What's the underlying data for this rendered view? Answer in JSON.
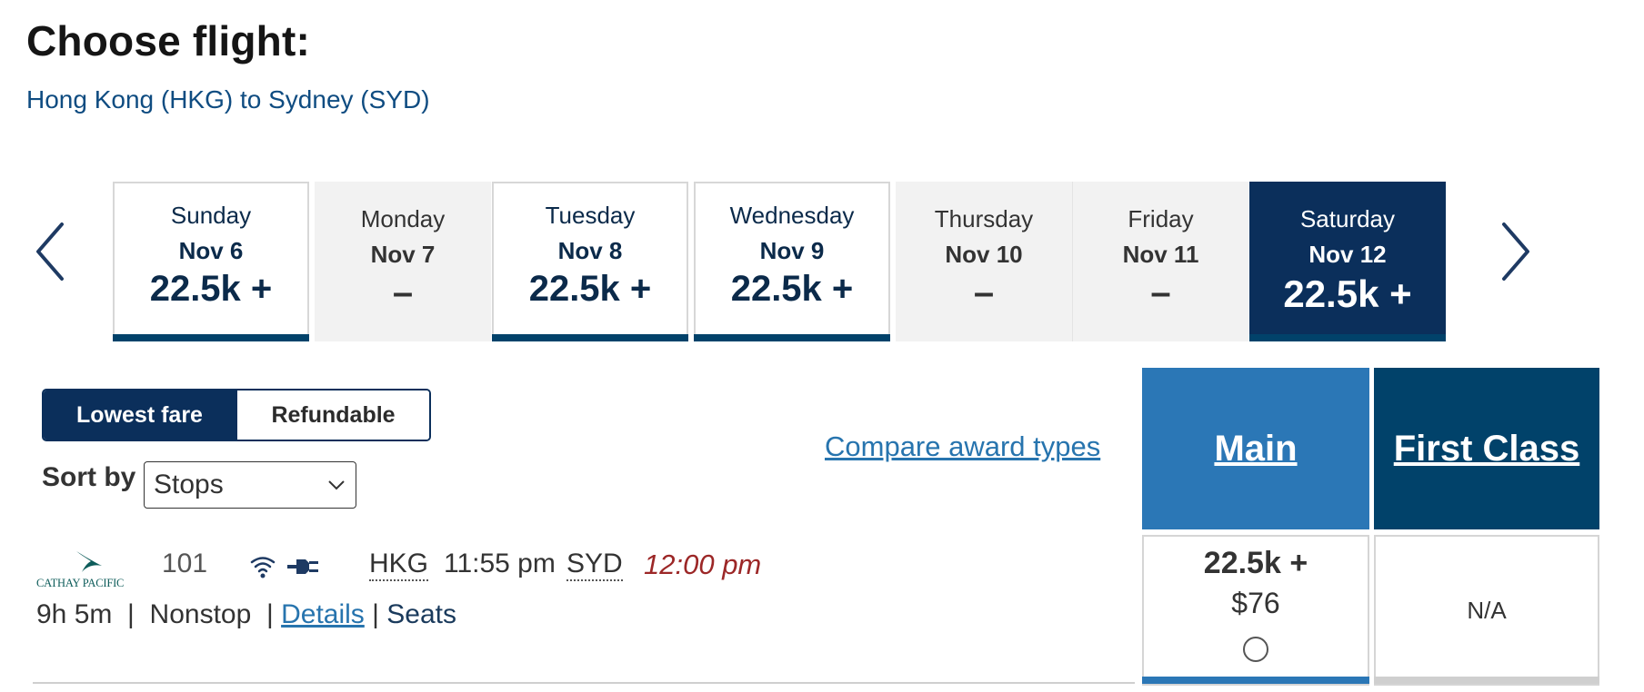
{
  "page": {
    "title": "Choose flight:",
    "route": "Hong Kong (HKG) to Sydney (SYD)"
  },
  "date_strip": {
    "days": [
      {
        "day": "Sunday",
        "date": "Nov 6",
        "price": "22.5k +"
      },
      {
        "day": "Monday",
        "date": "Nov 7",
        "price": "–"
      },
      {
        "day": "Tuesday",
        "date": "Nov 8",
        "price": "22.5k +"
      },
      {
        "day": "Wednesday",
        "date": "Nov 9",
        "price": "22.5k +"
      },
      {
        "day": "Thursday",
        "date": "Nov 10",
        "price": "–"
      },
      {
        "day": "Friday",
        "date": "Nov 11",
        "price": "–"
      },
      {
        "day": "Saturday",
        "date": "Nov 12",
        "price": "22.5k +"
      }
    ]
  },
  "fare_toggle": {
    "lowest": "Lowest fare",
    "refundable": "Refundable"
  },
  "sort": {
    "label": "Sort by",
    "value": "Stops"
  },
  "compare_link": "Compare award types",
  "cabins": {
    "main": "Main",
    "first": "First Class"
  },
  "flight": {
    "airline": "CATHAY PACIFIC",
    "number": "101",
    "origin": "HKG",
    "depart": "11:55 pm",
    "destination": "SYD",
    "arrive": "12:00 pm",
    "duration": "9h 5m",
    "stops": "Nonstop",
    "details": "Details",
    "seats": "Seats",
    "main_fare": {
      "miles": "22.5k +",
      "cash": "$76"
    },
    "first_fare": "N/A"
  },
  "colors": {
    "navy": "#0b2f5b",
    "main_blue": "#2b77b6",
    "first_blue": "#01426a",
    "link": "#2774ae",
    "arrival_red": "#9c2727"
  }
}
